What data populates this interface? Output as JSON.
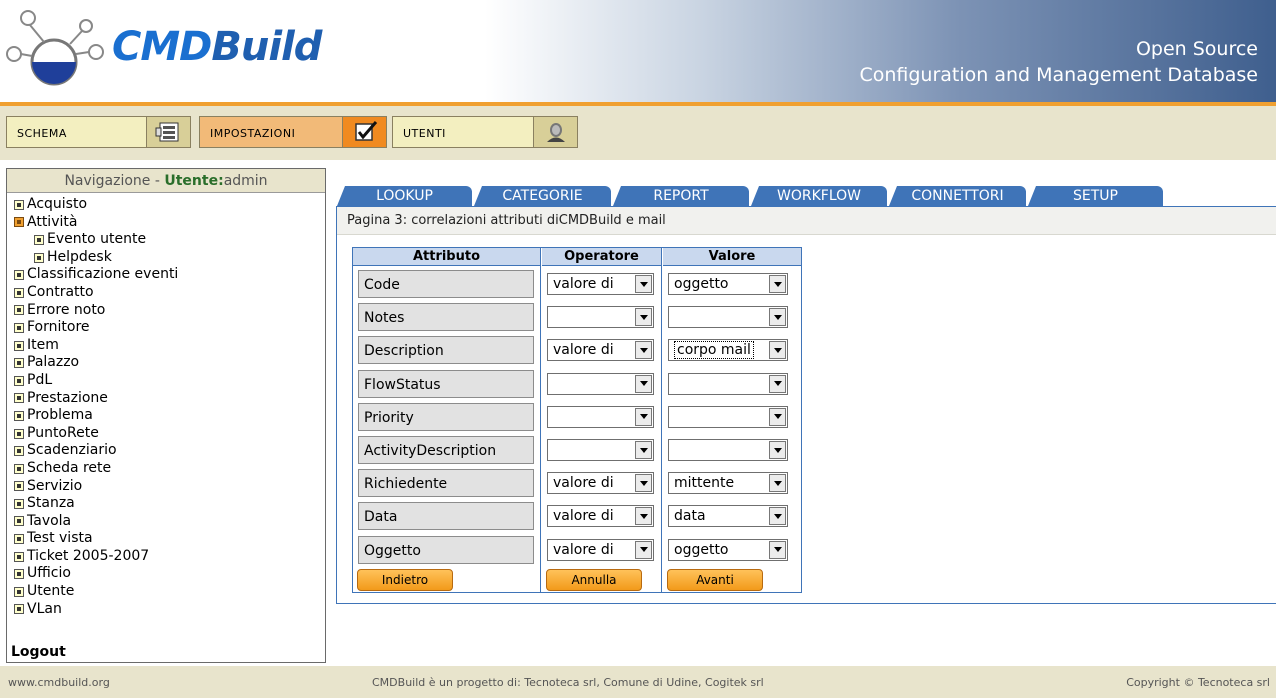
{
  "header": {
    "logo_text_a": "CMD",
    "logo_text_b": "Build",
    "tagline_1": "Open Source",
    "tagline_2": "Configuration and Management Database"
  },
  "toolbar": {
    "buttons": [
      {
        "label": "SCHEMA",
        "icon": "schema-icon"
      },
      {
        "label": "IMPOSTAZIONI",
        "icon": "checklist-icon"
      },
      {
        "label": "UTENTI",
        "icon": "user-icon"
      }
    ],
    "active": "IMPOSTAZIONI"
  },
  "sidebar": {
    "title_prefix": "Navigazione - ",
    "user_label": "Utente:",
    "user_name": "admin",
    "items": [
      {
        "label": "Acquisto",
        "level": 0
      },
      {
        "label": "Attività",
        "level": 0,
        "open": true
      },
      {
        "label": "Evento utente",
        "level": 1
      },
      {
        "label": "Helpdesk",
        "level": 1
      },
      {
        "label": "Classificazione eventi",
        "level": 0
      },
      {
        "label": "Contratto",
        "level": 0
      },
      {
        "label": "Errore noto",
        "level": 0
      },
      {
        "label": "Fornitore",
        "level": 0
      },
      {
        "label": "Item",
        "level": 0
      },
      {
        "label": "Palazzo",
        "level": 0
      },
      {
        "label": "PdL",
        "level": 0
      },
      {
        "label": "Prestazione",
        "level": 0
      },
      {
        "label": "Problema",
        "level": 0
      },
      {
        "label": "PuntoRete",
        "level": 0
      },
      {
        "label": "Scadenziario",
        "level": 0
      },
      {
        "label": "Scheda rete",
        "level": 0
      },
      {
        "label": "Servizio",
        "level": 0
      },
      {
        "label": "Stanza",
        "level": 0
      },
      {
        "label": "Tavola",
        "level": 0
      },
      {
        "label": "Test vista",
        "level": 0
      },
      {
        "label": "Ticket 2005-2007",
        "level": 0
      },
      {
        "label": "Ufficio",
        "level": 0
      },
      {
        "label": "Utente",
        "level": 0
      },
      {
        "label": "VLan",
        "level": 0
      }
    ],
    "logout": "Logout"
  },
  "tabs": [
    "LOOKUP",
    "CATEGORIE",
    "REPORT",
    "WORKFLOW",
    "CONNETTORI",
    "SETUP"
  ],
  "main": {
    "page_title": "Pagina 3: correlazioni attributi diCMDBuild e mail",
    "headers": {
      "attribute": "Attributo",
      "operator": "Operatore",
      "value": "Valore"
    },
    "rows": [
      {
        "attribute": "Code",
        "operator": "valore di",
        "value": "oggetto"
      },
      {
        "attribute": "Notes",
        "operator": "",
        "value": ""
      },
      {
        "attribute": "Description",
        "operator": "valore di",
        "value": "corpo mail",
        "focused": true
      },
      {
        "attribute": "FlowStatus",
        "operator": "",
        "value": ""
      },
      {
        "attribute": "Priority",
        "operator": "",
        "value": ""
      },
      {
        "attribute": "ActivityDescription",
        "operator": "",
        "value": ""
      },
      {
        "attribute": "Richiedente",
        "operator": "valore di",
        "value": "mittente"
      },
      {
        "attribute": "Data",
        "operator": "valore di",
        "value": "data"
      },
      {
        "attribute": "Oggetto",
        "operator": "valore di",
        "value": "oggetto"
      }
    ],
    "buttons": {
      "back": "Indietro",
      "cancel": "Annulla",
      "next": "Avanti"
    }
  },
  "footer": {
    "left": "www.cmdbuild.org",
    "center": "CMDBuild è un progetto di: Tecnoteca srl, Comune di Udine, Cogitek srl",
    "right": "Copyright © Tecnoteca srl"
  }
}
